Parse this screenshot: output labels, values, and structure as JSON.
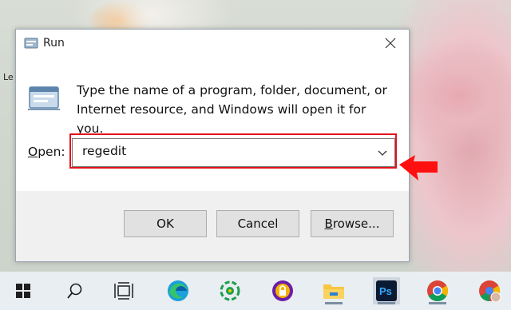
{
  "desktop": {
    "label_1": "Le",
    "label_2": "",
    "label_3": ""
  },
  "dialog": {
    "title": "Run",
    "description": "Type the name of a program, folder, document, or Internet resource, and Windows will open it for you.",
    "open_label_prefix": "O",
    "open_label_rest": "pen:",
    "open_value": "regedit",
    "ok_label": "OK",
    "cancel_label": "Cancel",
    "browse_label_prefix": "B",
    "browse_label_rest": "rowse..."
  },
  "annotation": {
    "highlight_color": "#e4131b",
    "arrow_color": "#ff1010"
  },
  "taskbar": {
    "items": [
      {
        "icon": "windows-start-icon"
      },
      {
        "icon": "search-icon"
      },
      {
        "icon": "task-view-icon"
      },
      {
        "icon": "edge-browser-icon"
      },
      {
        "icon": "coc-coc-browser-icon"
      },
      {
        "icon": "vpn-lock-icon"
      },
      {
        "icon": "file-explorer-icon"
      },
      {
        "icon": "photoshop-icon",
        "label": "Ps"
      },
      {
        "icon": "chrome-icon"
      },
      {
        "icon": "chrome-profile-icon"
      }
    ]
  }
}
